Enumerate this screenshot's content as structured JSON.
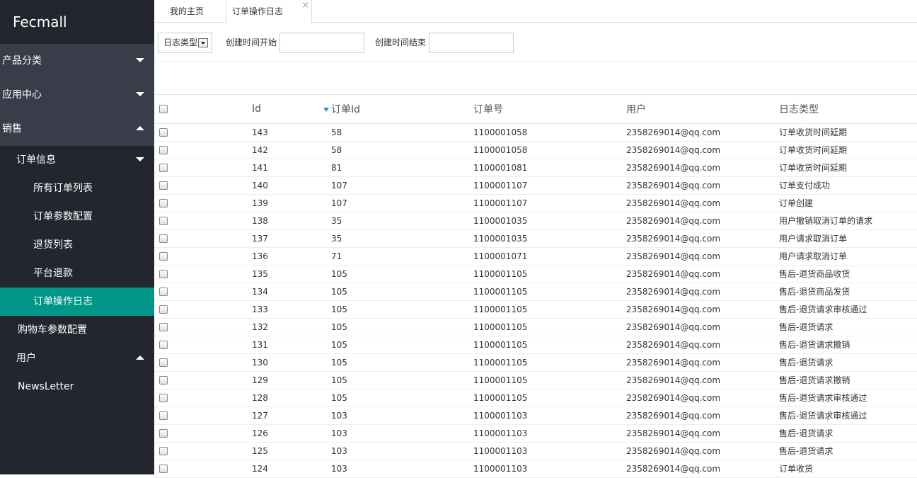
{
  "sidebar": {
    "brand": "Fecmall",
    "menu": [
      {
        "label": "产品分类",
        "state": "closed"
      },
      {
        "label": "应用中心",
        "state": "closed"
      },
      {
        "label": "销售",
        "state": "open"
      }
    ],
    "sales_sub": {
      "group_label": "订单信息",
      "items": [
        "所有订单列表",
        "订单参数配置",
        "退货列表",
        "平台退款",
        "订单操作日志"
      ],
      "cart_config": "购物车参数配置",
      "user_group": "用户",
      "newsletter": "NewsLetter"
    }
  },
  "tabs": {
    "home": "我的主页",
    "current": "订单操作日志",
    "close_glyph": "×"
  },
  "filters": {
    "log_type_select": "日志类型",
    "created_start_label": "创建时间开始",
    "created_end_label": "创建时间结束",
    "created_start_value": "",
    "created_end_value": ""
  },
  "table": {
    "headers": [
      "Id",
      "订单Id",
      "订单号",
      "用户",
      "日志类型"
    ],
    "rows": [
      [
        "143",
        "58",
        "1100001058",
        "2358269014@qq.com",
        "订单收货时间延期"
      ],
      [
        "142",
        "58",
        "1100001058",
        "2358269014@qq.com",
        "订单收货时间延期"
      ],
      [
        "141",
        "81",
        "1100001081",
        "2358269014@qq.com",
        "订单收货时间延期"
      ],
      [
        "140",
        "107",
        "1100001107",
        "2358269014@qq.com",
        "订单支付成功"
      ],
      [
        "139",
        "107",
        "1100001107",
        "2358269014@qq.com",
        "订单创建"
      ],
      [
        "138",
        "35",
        "1100001035",
        "2358269014@qq.com",
        "用户撤销取消订单的请求"
      ],
      [
        "137",
        "35",
        "1100001035",
        "2358269014@qq.com",
        "用户请求取消订单"
      ],
      [
        "136",
        "71",
        "1100001071",
        "2358269014@qq.com",
        "用户请求取消订单"
      ],
      [
        "135",
        "105",
        "1100001105",
        "2358269014@qq.com",
        "售后-退货商品收货"
      ],
      [
        "134",
        "105",
        "1100001105",
        "2358269014@qq.com",
        "售后-退货商品发货"
      ],
      [
        "133",
        "105",
        "1100001105",
        "2358269014@qq.com",
        "售后-退货请求审核通过"
      ],
      [
        "132",
        "105",
        "1100001105",
        "2358269014@qq.com",
        "售后-退货请求"
      ],
      [
        "131",
        "105",
        "1100001105",
        "2358269014@qq.com",
        "售后-退货请求撤销"
      ],
      [
        "130",
        "105",
        "1100001105",
        "2358269014@qq.com",
        "售后-退货请求"
      ],
      [
        "129",
        "105",
        "1100001105",
        "2358269014@qq.com",
        "售后-退货请求撤销"
      ],
      [
        "128",
        "105",
        "1100001105",
        "2358269014@qq.com",
        "售后-退货请求审核通过"
      ],
      [
        "127",
        "103",
        "1100001103",
        "2358269014@qq.com",
        "售后-退货请求审核通过"
      ],
      [
        "126",
        "103",
        "1100001103",
        "2358269014@qq.com",
        "售后-退货请求"
      ],
      [
        "125",
        "103",
        "1100001103",
        "2358269014@qq.com",
        "售后-退货请求"
      ],
      [
        "124",
        "103",
        "1100001103",
        "2358269014@qq.com",
        "订单收货"
      ]
    ]
  },
  "colors": {
    "sidebar_bg": "#23262e",
    "sidebar_group_bg": "#393d49",
    "active_item": "#009688",
    "sort_icon": "#3a8fc0"
  }
}
